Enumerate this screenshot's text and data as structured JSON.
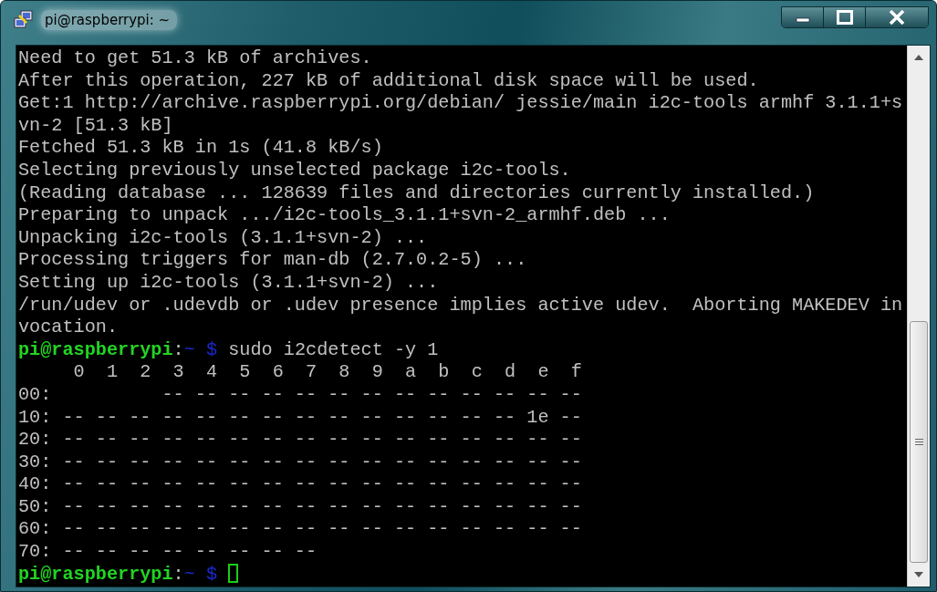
{
  "window": {
    "title": "pi@raspberrypi: ~"
  },
  "terminal": {
    "lines": [
      {
        "kind": "output",
        "text": "Need to get 51.3 kB of archives."
      },
      {
        "kind": "output",
        "text": "After this operation, 227 kB of additional disk space will be used."
      },
      {
        "kind": "output",
        "text": "Get:1 http://archive.raspberrypi.org/debian/ jessie/main i2c-tools armhf 3.1.1+s"
      },
      {
        "kind": "output",
        "text": "vn-2 [51.3 kB]"
      },
      {
        "kind": "output",
        "text": "Fetched 51.3 kB in 1s (41.8 kB/s)"
      },
      {
        "kind": "output",
        "text": "Selecting previously unselected package i2c-tools."
      },
      {
        "kind": "output",
        "text": "(Reading database ... 128639 files and directories currently installed.)"
      },
      {
        "kind": "output",
        "text": "Preparing to unpack .../i2c-tools_3.1.1+svn-2_armhf.deb ..."
      },
      {
        "kind": "output",
        "text": "Unpacking i2c-tools (3.1.1+svn-2) ..."
      },
      {
        "kind": "output",
        "text": "Processing triggers for man-db (2.7.0.2-5) ..."
      },
      {
        "kind": "output",
        "text": "Setting up i2c-tools (3.1.1+svn-2) ..."
      },
      {
        "kind": "output",
        "text": "/run/udev or .udevdb or .udev presence implies active udev.  Aborting MAKEDEV in"
      },
      {
        "kind": "output",
        "text": "vocation."
      },
      {
        "kind": "prompt",
        "user_host": "pi@raspberrypi",
        "separator": ":",
        "path": "~",
        "symbol": "$",
        "command": "sudo i2cdetect -y 1"
      },
      {
        "kind": "output",
        "text": "     0  1  2  3  4  5  6  7  8  9  a  b  c  d  e  f"
      },
      {
        "kind": "output",
        "text": "00:          -- -- -- -- -- -- -- -- -- -- -- -- --"
      },
      {
        "kind": "output",
        "text": "10: -- -- -- -- -- -- -- -- -- -- -- -- -- -- 1e --"
      },
      {
        "kind": "output",
        "text": "20: -- -- -- -- -- -- -- -- -- -- -- -- -- -- -- --"
      },
      {
        "kind": "output",
        "text": "30: -- -- -- -- -- -- -- -- -- -- -- -- -- -- -- --"
      },
      {
        "kind": "output",
        "text": "40: -- -- -- -- -- -- -- -- -- -- -- -- -- -- -- --"
      },
      {
        "kind": "output",
        "text": "50: -- -- -- -- -- -- -- -- -- -- -- -- -- -- -- --"
      },
      {
        "kind": "output",
        "text": "60: -- -- -- -- -- -- -- -- -- -- -- -- -- -- -- --"
      },
      {
        "kind": "output",
        "text": "70: -- -- -- -- -- -- -- --"
      },
      {
        "kind": "prompt",
        "user_host": "pi@raspberrypi",
        "separator": ":",
        "path": "~",
        "symbol": "$",
        "cursor": true
      }
    ]
  }
}
